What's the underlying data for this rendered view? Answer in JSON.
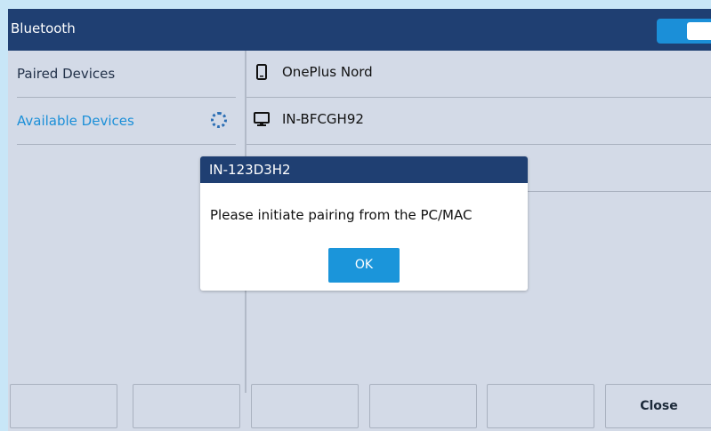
{
  "app": {
    "title": "Bluetooth",
    "bluetooth_enabled": true
  },
  "sidebar": {
    "items": [
      {
        "label": "Paired Devices",
        "active": false
      },
      {
        "label": "Available Devices",
        "active": true
      }
    ]
  },
  "devices": [
    {
      "name": "OnePlus Nord",
      "icon": "phone-icon"
    },
    {
      "name": "IN-BFCGH92",
      "icon": "computer-icon"
    }
  ],
  "softkeys": [
    "",
    "",
    "",
    "",
    "",
    "Close"
  ],
  "dialog": {
    "title": "IN-123D3H2",
    "message": "Please initiate pairing from the PC/MAC",
    "ok_label": "OK"
  },
  "colors": {
    "header": "#1f3f72",
    "accent": "#1b8fd8",
    "background": "#d3dae7"
  }
}
